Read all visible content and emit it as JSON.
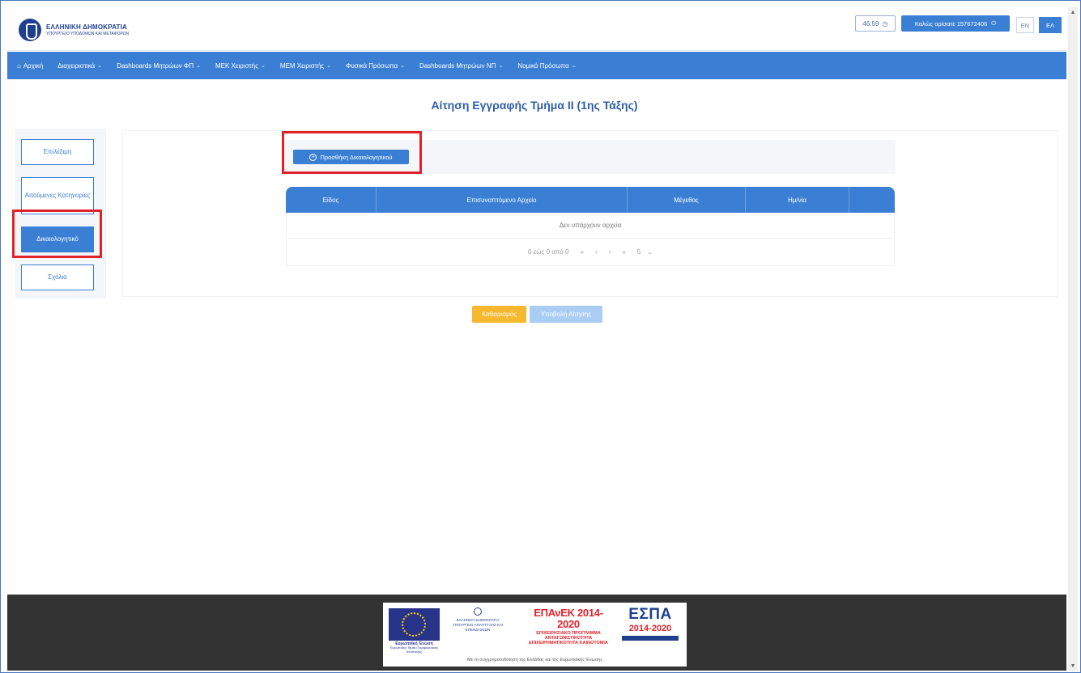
{
  "header": {
    "logo_title": "ΕΛΛΗΝΙΚΗ ΔΗΜΟΚΡΑΤΙΑ",
    "logo_subtitle": "ΥΠΟΥΡΓΕΙΟ ΥΠΟΔΟΜΩΝ ΚΑΙ ΜΕΤΑΦΟΡΩΝ",
    "timer": "46:59",
    "welcome": "Καλώς ορίσατε 157672406",
    "lang_en": "EN",
    "lang_el": "ΕΛ"
  },
  "nav": {
    "items": [
      {
        "label": "Αρχική",
        "has_dropdown": false
      },
      {
        "label": "Διαχειριστικά",
        "has_dropdown": true
      },
      {
        "label": "Dashboards Μητρώων ΦΠ",
        "has_dropdown": true
      },
      {
        "label": "ΜΕΚ Χειριστής",
        "has_dropdown": true
      },
      {
        "label": "ΜΕΜ Χειριστής",
        "has_dropdown": true
      },
      {
        "label": "Φυσικά Πρόσωπα",
        "has_dropdown": true
      },
      {
        "label": "Dashboards Μητρώων ΝΠ",
        "has_dropdown": true
      },
      {
        "label": "Νομικά Πρόσωπα",
        "has_dropdown": true
      }
    ]
  },
  "page": {
    "title": "Αίτηση Εγγραφής Τμήμα ΙΙ (1ης Τάξης)"
  },
  "sidebar": {
    "items": [
      {
        "label": "Επιλέξιμη",
        "active": false
      },
      {
        "label": "Αιτούμενες Κατηγορίες",
        "active": false
      },
      {
        "label": "Δικαιολογητικό",
        "active": true
      },
      {
        "label": "Σχόλια",
        "active": false
      }
    ]
  },
  "documents": {
    "add_button": "Προσθήκη Δικαιολογητικού",
    "table": {
      "columns": [
        "Είδος",
        "Επισυναπτόμενο Αρχείο",
        "Μέγεθος",
        "Ημ/νία",
        ""
      ],
      "empty_text": "Δεν υπάρχουν αρχεία",
      "pager": {
        "summary": "0 εώς 0 από 0",
        "first": "«",
        "prev": "‹",
        "next": "›",
        "last": "»",
        "page_size": "5"
      }
    }
  },
  "actions": {
    "clear": "Καθαρισμός",
    "submit": "Υποβολή Αίτησης"
  },
  "footer": {
    "eu_label": "Ευρωπαϊκή Ένωση",
    "eu_fund": "Ευρωπαϊκό Ταμείο Περιφερειακής Ανάπτυξης",
    "gov_text": "ΕΛΛΗΝΙΚΗ ΔΗΜΟΚΡΑΤΙΑ ΥΠΟΥΡΓΕΙΟ ΑΝΑΠΤΥΞΗΣ ΚΑΙ ΕΠΕΝΔΥΣΕΩΝ",
    "epanek_title": "ΕΠΑνΕΚ 2014-2020",
    "epanek_sub": "ΕΠΙΧΕΙΡΗΣΙΑΚΟ ΠΡΟΓΡΑΜΜΑ ΑΝΤΑΓΩΝΙΣΤΙΚΟΤΗΤΑ ΕΠΙΧΕΙΡΗΜΑΤΙΚΟΤΗΤΑ ΚΑΙΝΟΤΟΜΙΑ",
    "espa_word": "ΕΣΠΑ",
    "espa_years": "2014-2020",
    "caption": "Με τη συγχρηματοδότηση της Ελλάδας και της Ευρωπαϊκής Ένωσης"
  },
  "colors": {
    "primary": "#3b7fd4",
    "warning": "#f5b82e",
    "highlight": "#e0232b",
    "footer_bg": "#333333"
  }
}
